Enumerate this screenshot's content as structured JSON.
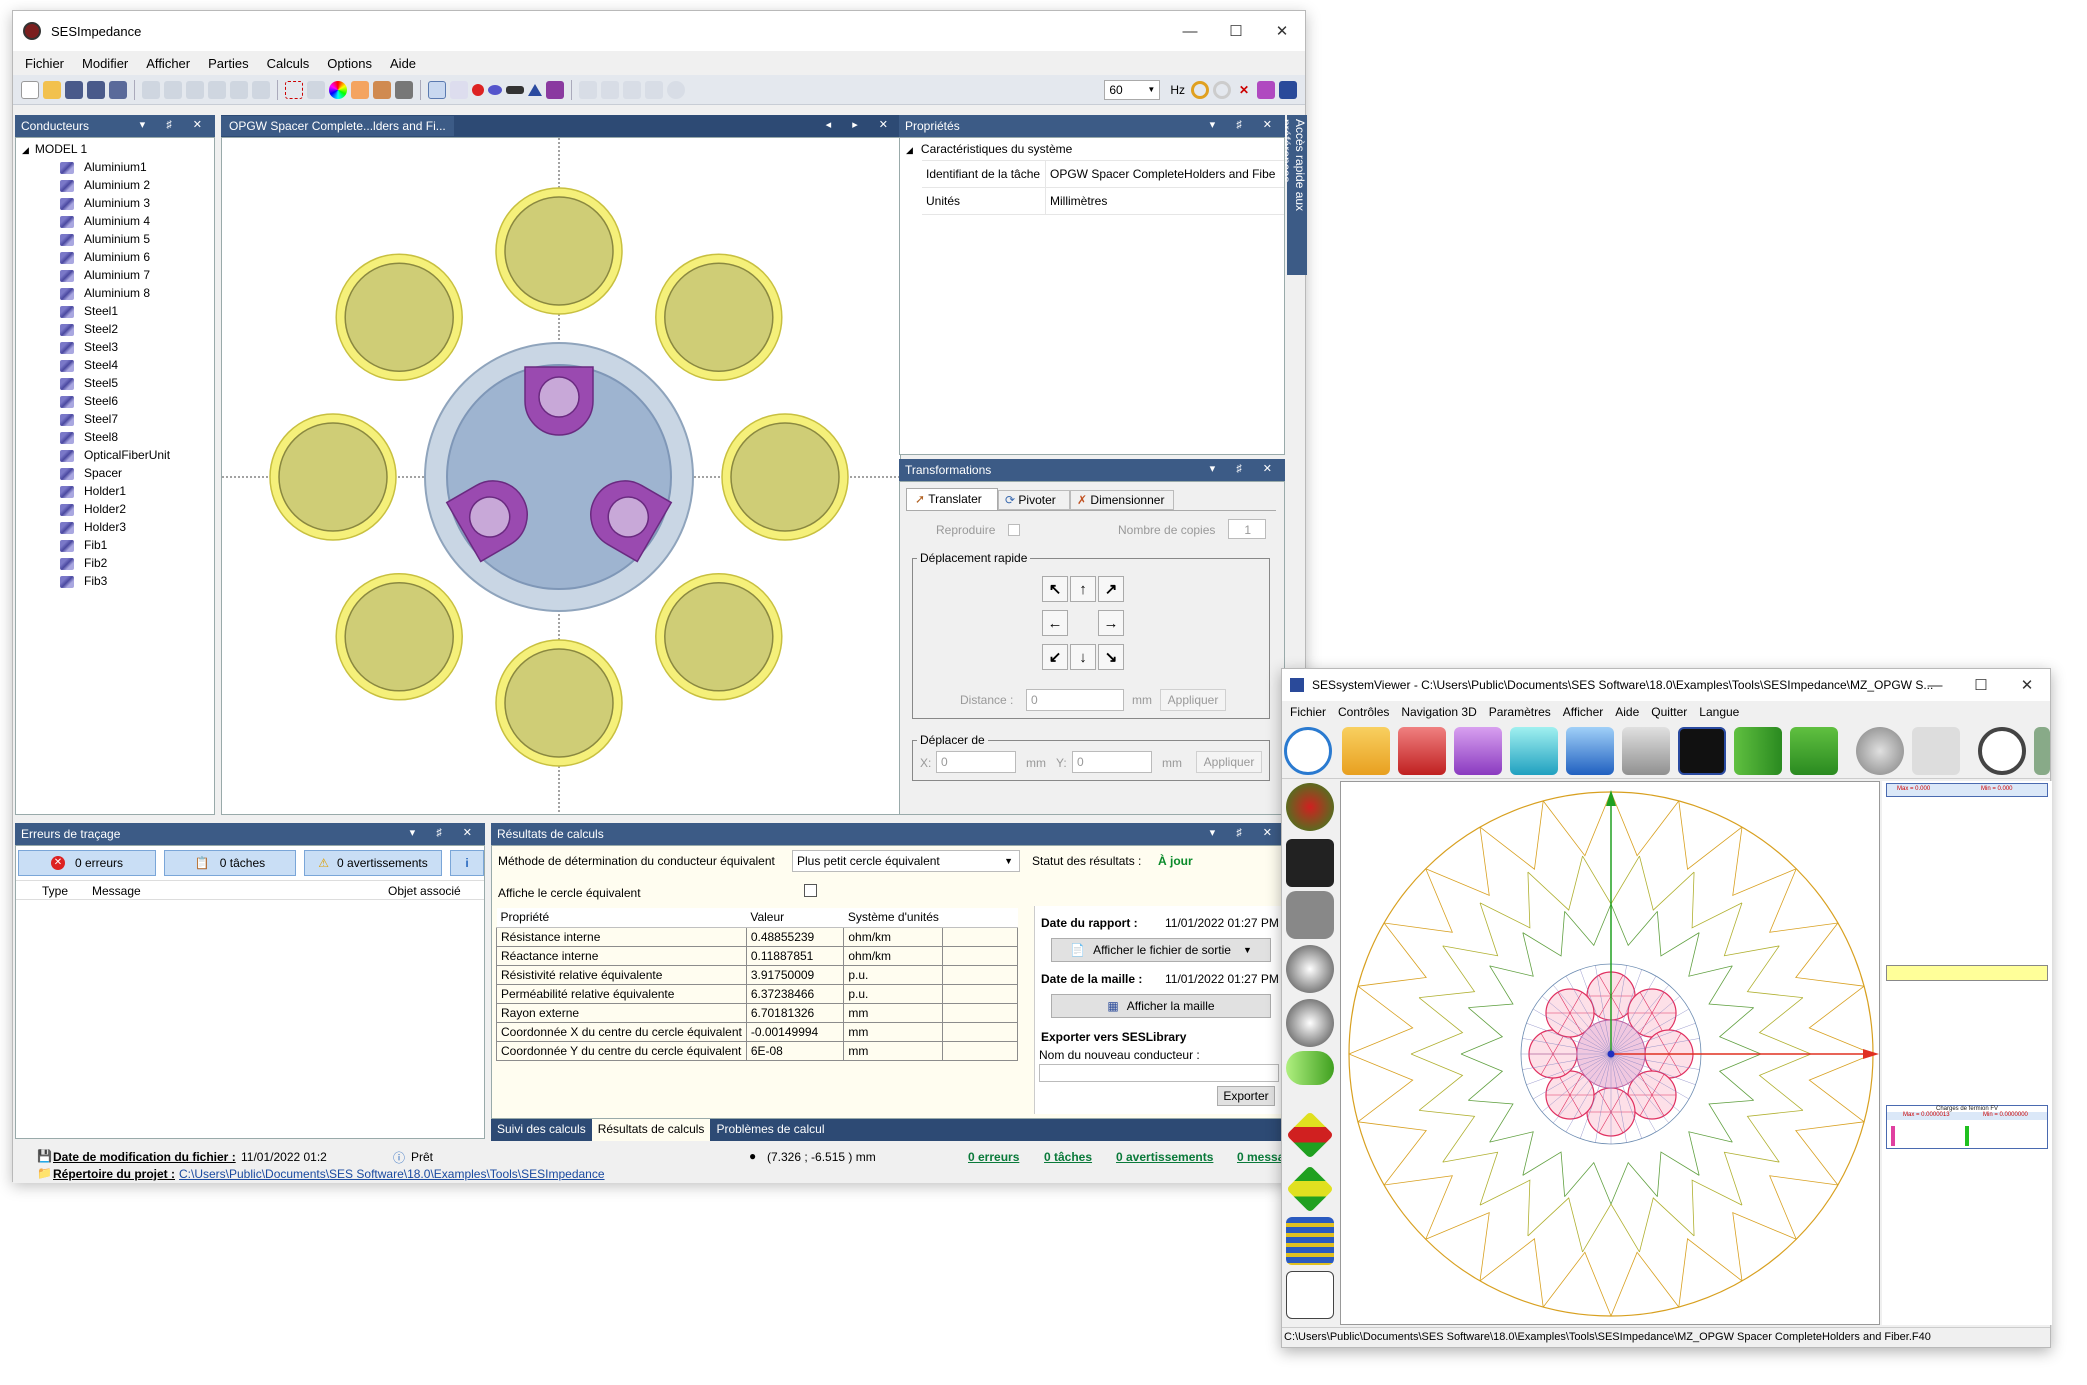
{
  "main": {
    "title": "SESImpedance",
    "menu": [
      "Fichier",
      "Modifier",
      "Afficher",
      "Parties",
      "Calculs",
      "Options",
      "Aide"
    ],
    "freq_value": "60",
    "freq_unit": "Hz",
    "side_tab": "Accès rapide aux préférences",
    "conductors_panel": {
      "title": "Conducteurs",
      "root": "MODEL 1",
      "items": [
        "Aluminium1",
        "Aluminium 2",
        "Aluminium 3",
        "Aluminium 4",
        "Aluminium 5",
        "Aluminium 6",
        "Aluminium 7",
        "Aluminium 8",
        "Steel1",
        "Steel2",
        "Steel3",
        "Steel4",
        "Steel5",
        "Steel6",
        "Steel7",
        "Steel8",
        "OpticalFiberUnit",
        "Spacer",
        "Holder1",
        "Holder2",
        "Holder3",
        "Fib1",
        "Fib2",
        "Fib3"
      ]
    },
    "canvas_tab": "OPGW Spacer Complete...lders and Fi...",
    "properties_panel": {
      "title": "Propriétés",
      "section": "Caractéristiques du système",
      "rows": [
        {
          "label": "Identifiant de la tâche",
          "value": "OPGW Spacer CompleteHolders and Fiber"
        },
        {
          "label": "Unités",
          "value": "Millimètres"
        }
      ]
    },
    "transform_panel": {
      "title": "Transformations",
      "tabs": [
        "Translater",
        "Pivoter",
        "Dimensionner"
      ],
      "reproduce_label": "Reproduire",
      "copies_label": "Nombre de copies",
      "copies_value": "1",
      "quick_move_title": "Déplacement rapide",
      "distance_label": "Distance :",
      "distance_value": "0",
      "mm": "mm",
      "apply": "Appliquer",
      "move_to_title": "Déplacer de",
      "x_label": "X:",
      "x_value": "0",
      "y_label": "Y:",
      "y_value": "0"
    },
    "errors_panel": {
      "title": "Erreurs de traçage",
      "errors_btn": "0 erreurs",
      "tasks_btn": "0 tâches",
      "warnings_btn": "0 avertissements",
      "columns": [
        "Type",
        "Message",
        "Objet associé"
      ]
    },
    "results_panel": {
      "title": "Résultats de calculs",
      "method_label": "Méthode de détermination du conducteur équivalent",
      "method_value": "Plus petit cercle équivalent",
      "status_label": "Statut des résultats :",
      "status_value": "À jour",
      "show_circle_label": "Affiche le cercle équivalent",
      "table_headers": [
        "Propriété",
        "Valeur",
        "Système d'unités"
      ],
      "table_rows": [
        [
          "Résistance interne",
          "0.48855239",
          "ohm/km"
        ],
        [
          "Réactance interne",
          "0.11887851",
          "ohm/km"
        ],
        [
          "Résistivité relative équivalente",
          "3.91750009",
          "p.u."
        ],
        [
          "Perméabilité relative équivalente",
          "6.37238466",
          "p.u."
        ],
        [
          "Rayon externe",
          "6.70181326",
          "mm"
        ],
        [
          "Coordonnée X du centre du cercle équivalent",
          "-0.00149994",
          "mm"
        ],
        [
          "Coordonnée Y du centre du cercle équivalent",
          "6E-08",
          "mm"
        ]
      ],
      "report_date_label": "Date du rapport :",
      "report_date_value": "11/01/2022 01:27 PM",
      "output_btn": "Afficher le fichier de sortie",
      "mesh_date_label": "Date de la maille :",
      "mesh_date_value": "11/01/2022 01:27 PM",
      "mesh_btn": "Afficher la maille",
      "export_title": "Exporter vers SESLibrary",
      "new_conductor_label": "Nom du nouveau conducteur :",
      "export_btn": "Exporter",
      "bottom_tabs": [
        "Suivi des calculs",
        "Résultats de calculs",
        "Problèmes de calcul"
      ]
    },
    "status": {
      "modified_label": "Date de modification du fichier :",
      "modified_value": "11/01/2022 01:2",
      "ready": "Prêt",
      "coords": "(7.326 ; -6.515 ) mm",
      "errors": "0 erreurs",
      "tasks": "0 tâches",
      "warnings": "0 avertissements",
      "messages": "0 messa",
      "project_label": "Répertoire du projet :",
      "project_path": "C:\\Users\\Public\\Documents\\SES Software\\18.0\\Examples\\Tools\\SESImpedance"
    }
  },
  "viewer": {
    "title": "SESsystemViewer - C:\\Users\\Public\\Documents\\SES Software\\18.0\\Examples\\Tools\\SESImpedance\\MZ_OPGW S...",
    "menu": [
      "Fichier",
      "Contrôles",
      "Navigation 3D",
      "Paramètres",
      "Afficher",
      "Aide",
      "Quitter",
      "Langue"
    ],
    "legend_top": {
      "max": "Max = 0.000",
      "min": "Min = 0.000"
    },
    "legend_bottom": {
      "title": "Charges de fermion FV",
      "max": "Max = 0.0000013",
      "min": "Min = 0.0000000"
    },
    "path": "C:\\Users\\Public\\Documents\\SES Software\\18.0\\Examples\\Tools\\SESImpedance\\MZ_OPGW Spacer CompleteHolders and Fiber.F40"
  }
}
